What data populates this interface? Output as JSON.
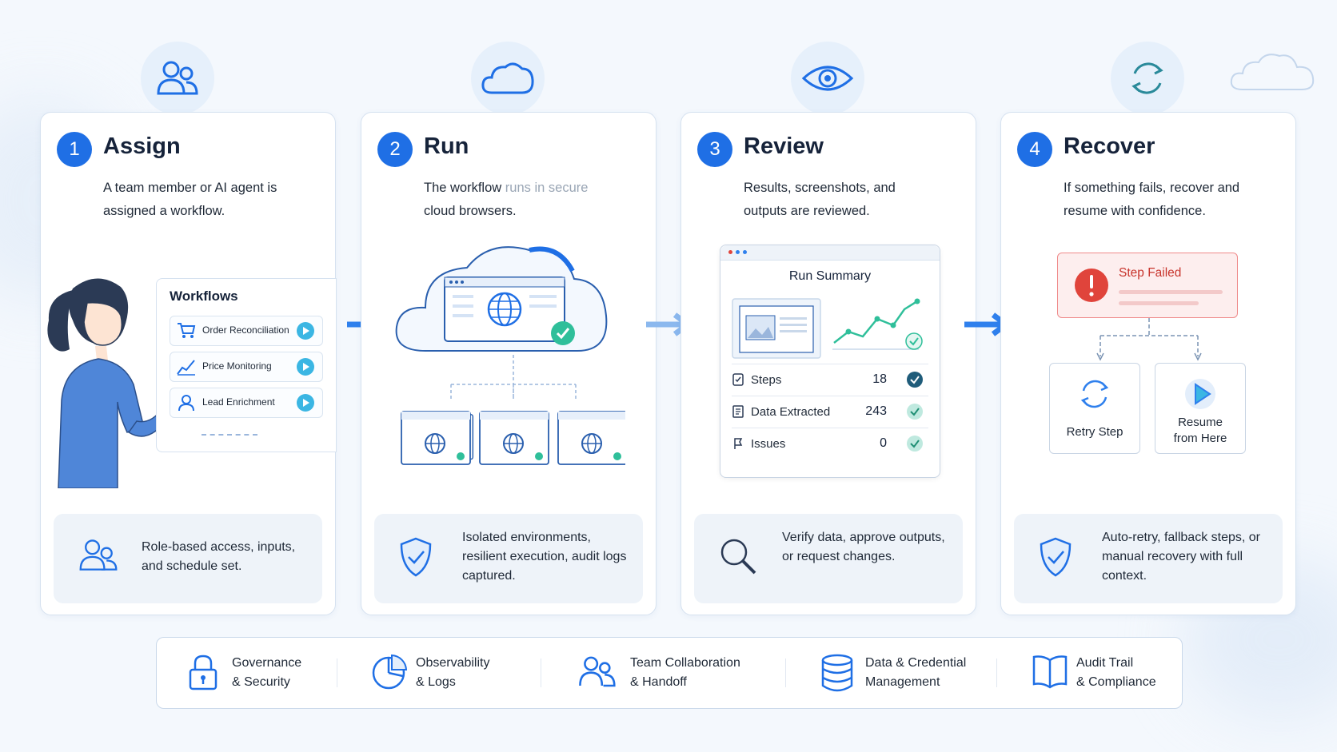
{
  "colors": {
    "accent": "#1f6fe5",
    "teal": "#3bb6e3",
    "success": "#2fbf9a",
    "error": "#e0443b",
    "background": "#f4f8fd"
  },
  "steps": [
    {
      "number": "1",
      "title": "Assign",
      "desc": "A team member or AI agent is assigned a workflow.",
      "footer": "Role-based access, inputs, and schedule set.",
      "header_icon": "users-icon",
      "footer_icon": "users-icon"
    },
    {
      "number": "2",
      "title": "Run",
      "desc_a": "The workflow ",
      "desc_b": "runs in secure",
      "desc_c": " cloud browsers.",
      "footer": "Isolated environments, resilient execution, audit logs captured.",
      "header_icon": "cloud-icon",
      "footer_icon": "shield-check-icon"
    },
    {
      "number": "3",
      "title": "Review",
      "desc": "Results, screenshots, and outputs are reviewed.",
      "footer": "Verify data, approve outputs, or request changes.",
      "header_icon": "eye-icon",
      "footer_icon": "magnifier-icon"
    },
    {
      "number": "4",
      "title": "Recover",
      "desc": "If something fails, recover and resume with confidence.",
      "footer": "Auto-retry, fallback steps, or manual recovery with full context.",
      "header_icon": "refresh-icon",
      "footer_icon": "shield-check-icon"
    }
  ],
  "workflows": {
    "title": "Workflows",
    "items": [
      {
        "label": "Order Reconciliation",
        "icon": "cart-icon"
      },
      {
        "label": "Price Monitoring",
        "icon": "chart-line-icon"
      },
      {
        "label": "Lead Enrichment",
        "icon": "user-icon"
      }
    ]
  },
  "run_summary": {
    "title": "Run Summary",
    "rows": [
      {
        "label": "Steps",
        "value": "18",
        "icon": "checklist-icon"
      },
      {
        "label": "Data Extracted",
        "value": "243",
        "icon": "document-icon"
      },
      {
        "label": "Issues",
        "value": "0",
        "icon": "flag-icon"
      }
    ]
  },
  "recover": {
    "failed_label": "Step Failed",
    "retry_label": "Retry Step",
    "resume_label_1": "Resume",
    "resume_label_2": "from Here"
  },
  "features": [
    {
      "line1": "Governance",
      "line2": "& Security",
      "icon": "lock-icon"
    },
    {
      "line1": "Observability",
      "line2": "& Logs",
      "icon": "pie-chart-icon"
    },
    {
      "line1": "Team Collaboration",
      "line2": "& Handoff",
      "icon": "users-icon"
    },
    {
      "line1": "Data & Credential",
      "line2": "Management",
      "icon": "database-icon"
    },
    {
      "line1": "Audit Trail",
      "line2": "& Compliance",
      "icon": "book-icon"
    }
  ]
}
